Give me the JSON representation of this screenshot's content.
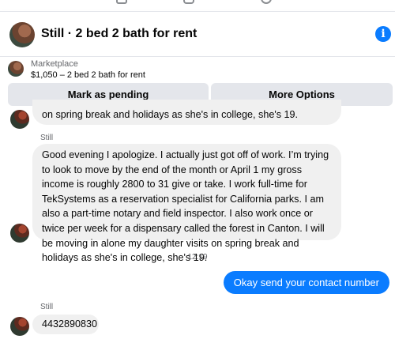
{
  "header": {
    "title": "Still · 2 bed 2 bath for rent",
    "info_icon": "i"
  },
  "context": {
    "label": "Marketplace",
    "listing": "$1,050 – 2 bed 2 bath for rent",
    "buttons": {
      "pending": "Mark as pending",
      "options": "More Options"
    }
  },
  "messages": {
    "partial": "on spring break and holidays as she's in college, she's 19.",
    "sender1": "Still",
    "long": "Good evening I apologize. I actually just got off of work. I’m trying to look to move by the end of the month or April 1 my gross income is roughly 2800 to 31 give or take. I work full-time for TekSystems as a reservation specialist for California parks. I am also a part-time notary and field inspector. I also work once or twice per week for a dispensary called the forest in Canton. I will be moving in alone my daughter visits on spring break and holidays as she's in college, she's 19.",
    "timestamp": "12:19",
    "outgoing": "Okay send your contact number",
    "sender2": "Still",
    "phone": "4432890830"
  },
  "colors": {
    "accent": "#0a7cff",
    "bubble_in": "#f0f0f0",
    "secondary_text": "#65676b"
  }
}
